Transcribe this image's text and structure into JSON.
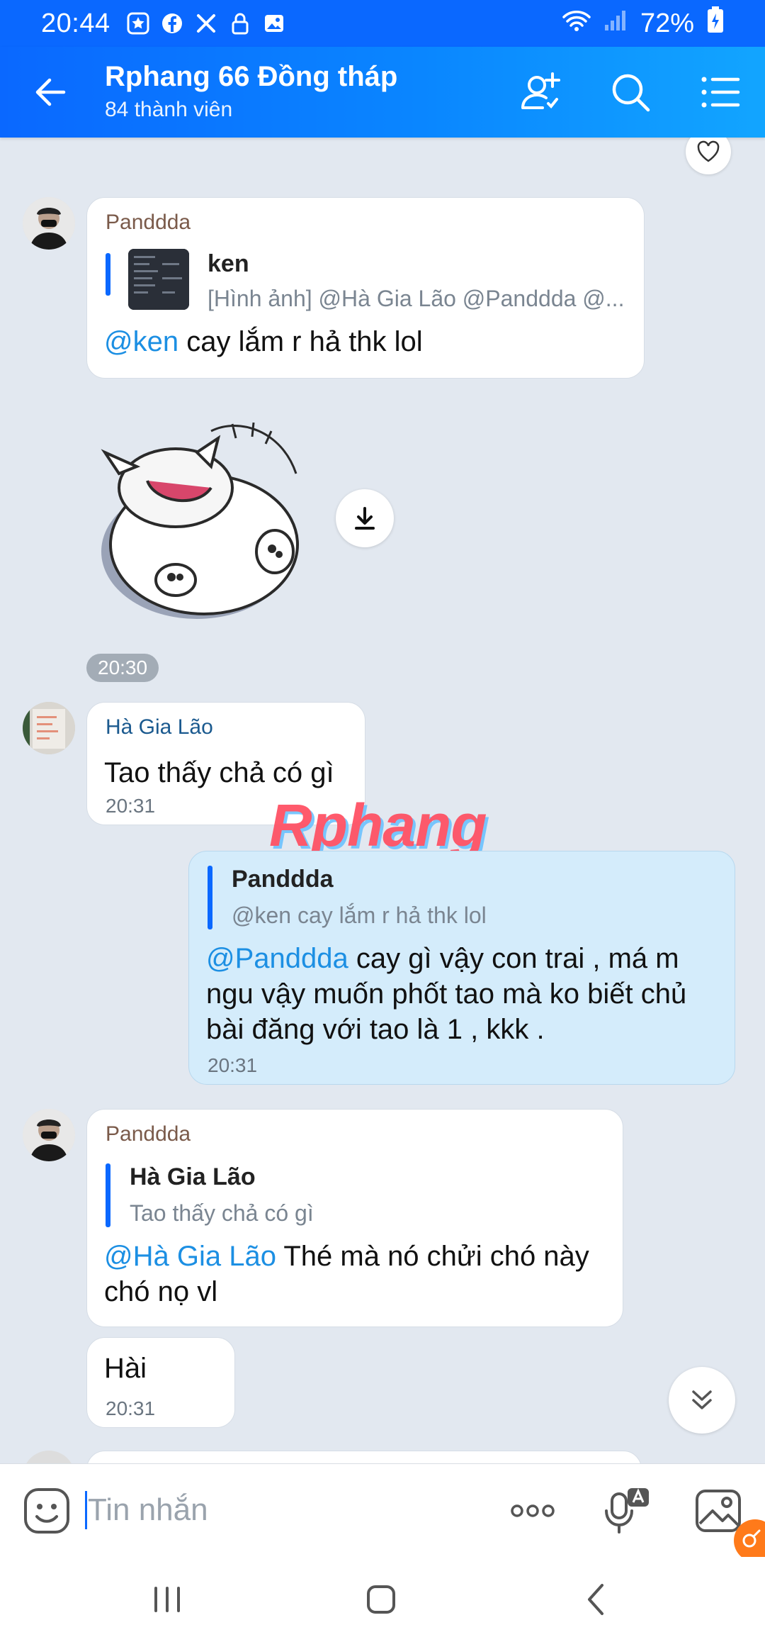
{
  "status_bar": {
    "time": "20:44",
    "battery": "72%",
    "icons": [
      "star-app-icon",
      "facebook-icon",
      "tools-icon",
      "lock-icon",
      "gallery-icon"
    ]
  },
  "header": {
    "title": "Rphang 66 Đồng tháp",
    "subtitle": "84 thành viên",
    "accent": "#0a68ff"
  },
  "messages": {
    "m1": {
      "sender": "Panddda",
      "quote_name": "ken",
      "quote_text": "[Hình ảnh] @Hà Gia Lão @Panddda @...",
      "mention": "@ken",
      "text": " cay lắm r hả thk lol"
    },
    "sticker_time": "20:30",
    "m2": {
      "sender": "Hà Gia Lão",
      "text": "Tao thấy chả có gì",
      "time": "20:31"
    },
    "m3": {
      "quote_name": "Panddda",
      "quote_text": "@ken cay lắm r hả thk lol",
      "mention": "@Panddda",
      "text": " cay gì vậy con trai , má m ngu vậy muốn phốt tao mà ko biết chủ bài đăng với tao là 1 , kkk .",
      "time": "20:31"
    },
    "m4": {
      "sender": "Panddda",
      "quote_name": "Hà Gia Lão",
      "quote_text": "Tao thấy chả có gì",
      "mention": "@Hà Gia Lão",
      "text": " Thé mà nó chửi chó này chó nọ vl"
    },
    "m5": {
      "text": "Hài",
      "time": "20:31"
    }
  },
  "watermark": "Rphang",
  "input": {
    "placeholder": "Tin nhắn",
    "more_label": "ooo"
  }
}
